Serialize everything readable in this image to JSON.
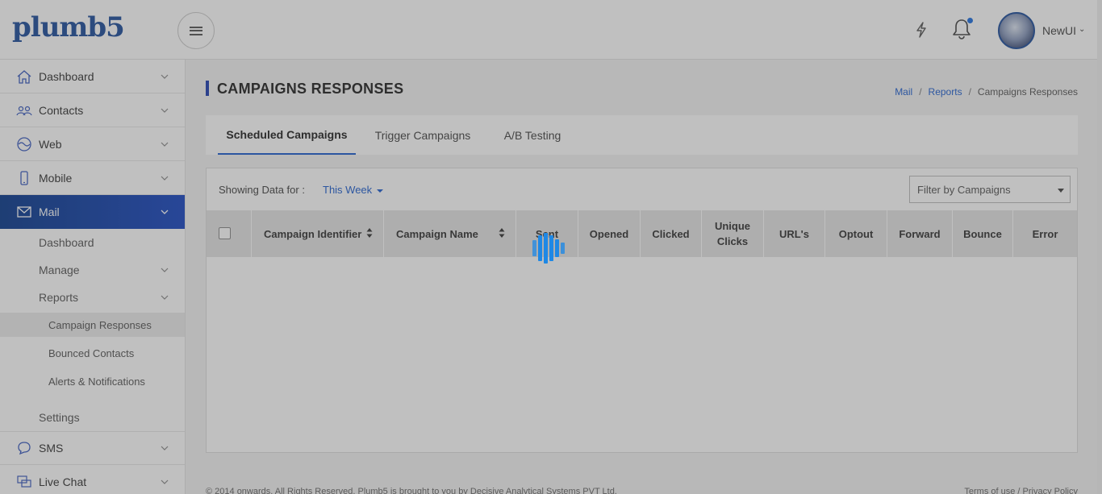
{
  "header": {
    "logo": "plumb5",
    "menu_icon": "hamburger-icon",
    "quick_icon": "lightning-icon",
    "bell_icon": "bell-icon",
    "user_name": "NewUI",
    "user_caret": "⌄"
  },
  "sidebar": {
    "items": [
      {
        "label": "Dashboard",
        "icon": "home-icon"
      },
      {
        "label": "Contacts",
        "icon": "contacts-icon"
      },
      {
        "label": "Web",
        "icon": "web-icon"
      },
      {
        "label": "Mobile",
        "icon": "mobile-icon"
      },
      {
        "label": "Mail",
        "icon": "mail-icon",
        "active": true
      },
      {
        "label": "SMS",
        "icon": "sms-icon"
      },
      {
        "label": "Live Chat",
        "icon": "live-chat-icon"
      }
    ],
    "mail_submenu": {
      "dashboard": "Dashboard",
      "manage": "Manage",
      "reports": "Reports",
      "reports_children": [
        "Campaign Responses",
        "Bounced Contacts",
        "Alerts & Notifications"
      ],
      "settings": "Settings"
    }
  },
  "page": {
    "title": "CAMPAIGNS RESPONSES",
    "breadcrumb": [
      "Mail",
      "Reports",
      "Campaigns Responses"
    ],
    "breadcrumb_sep": "/"
  },
  "tabs": [
    "Scheduled Campaigns",
    "Trigger Campaigns",
    "A/B Testing"
  ],
  "filters": {
    "showing_label": "Showing Data for :",
    "period": "This Week",
    "campaign_filter_placeholder": "Filter by Campaigns"
  },
  "table": {
    "columns": [
      "Campaign Identifier",
      "Campaign Name",
      "Sent",
      "Opened",
      "Clicked",
      "Unique Clicks",
      "URL's",
      "Optout",
      "Forward",
      "Bounce",
      "Error"
    ],
    "rows": []
  },
  "footer": {
    "copyright": "© 2014 onwards. All Rights Reserved. Plumb5 is brought to you by Decisive Analytical Systems PVT Ltd.",
    "terms": "Terms of use",
    "privacy": "Privacy Policy",
    "sep": " / "
  },
  "loader": "loading-spinner",
  "colors": {
    "brand": "#1f4e9c",
    "active_menu": "#1947c2",
    "link": "#1f5fcf",
    "loader": "#1e88e5"
  }
}
